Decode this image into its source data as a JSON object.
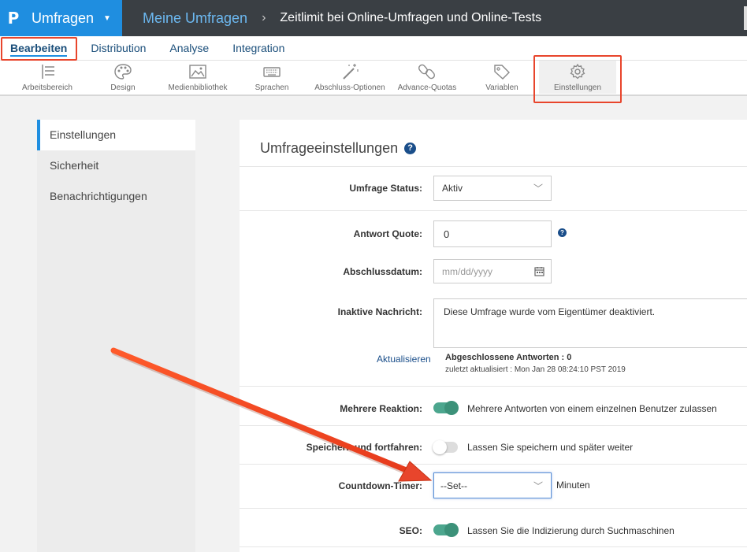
{
  "topbar": {
    "logo": "P",
    "brand_label": "Umfragen",
    "title": "Meine Umfragen",
    "separator": "›",
    "subtitle": "Zeitlimit bei Online-Umfragen und Online-Tests"
  },
  "main_tabs": [
    {
      "label": "Bearbeiten",
      "active": true
    },
    {
      "label": "Distribution"
    },
    {
      "label": "Analyse"
    },
    {
      "label": "Integration"
    }
  ],
  "toolbar": [
    {
      "label": "Arbeitsbereich",
      "icon": "list-icon"
    },
    {
      "label": "Design",
      "icon": "palette-icon"
    },
    {
      "label": "Medienbibliothek",
      "icon": "image-icon"
    },
    {
      "label": "Sprachen",
      "icon": "keyboard-icon"
    },
    {
      "label": "Abschluss-Optionen",
      "icon": "magic-wand-icon"
    },
    {
      "label": "Advance-Quotas",
      "icon": "link-icon"
    },
    {
      "label": "Variablen",
      "icon": "tag-icon"
    },
    {
      "label": "Einstellungen",
      "icon": "gear-icon",
      "active": true
    }
  ],
  "sidebar": [
    {
      "label": "Einstellungen",
      "active": true
    },
    {
      "label": "Sicherheit"
    },
    {
      "label": "Benachrichtigungen"
    }
  ],
  "panel": {
    "title": "Umfrageeinstellungen",
    "help": "?",
    "status_label": "Umfrage Status:",
    "status_value": "Aktiv",
    "quote_label": "Antwort Quote:",
    "quote_value": "0",
    "date_label": "Abschlussdatum:",
    "date_placeholder": "mm/dd/yyyy",
    "inactive_label": "Inaktive Nachricht:",
    "inactive_value": "Diese Umfrage wurde vom Eigentümer deaktiviert.",
    "refresh_link": "Aktualisieren",
    "completed_label": "Abgeschlossene Antworten : 0",
    "last_updated": "zuletzt aktualisiert : Mon Jan 28 08:24:10 PST 2019",
    "multi_label": "Mehrere Reaktion:",
    "multi_text": "Mehrere Antworten von einem einzelnen Benutzer zulassen",
    "multi_on": true,
    "save_label": "Speichern und fortfahren:",
    "save_text": "Lassen Sie speichern und später weiter",
    "save_on": false,
    "countdown_label": "Countdown-Timer:",
    "countdown_value": "--Set--",
    "countdown_unit": "Minuten",
    "seo_label": "SEO:",
    "seo_text": "Lassen Sie die Indizierung durch Suchmaschinen",
    "seo_on": true
  },
  "colors": {
    "accent": "#1f8ee0",
    "topbar": "#3a3f44",
    "highlight": "#e8452c",
    "toggle_on": "#4ca68e"
  }
}
